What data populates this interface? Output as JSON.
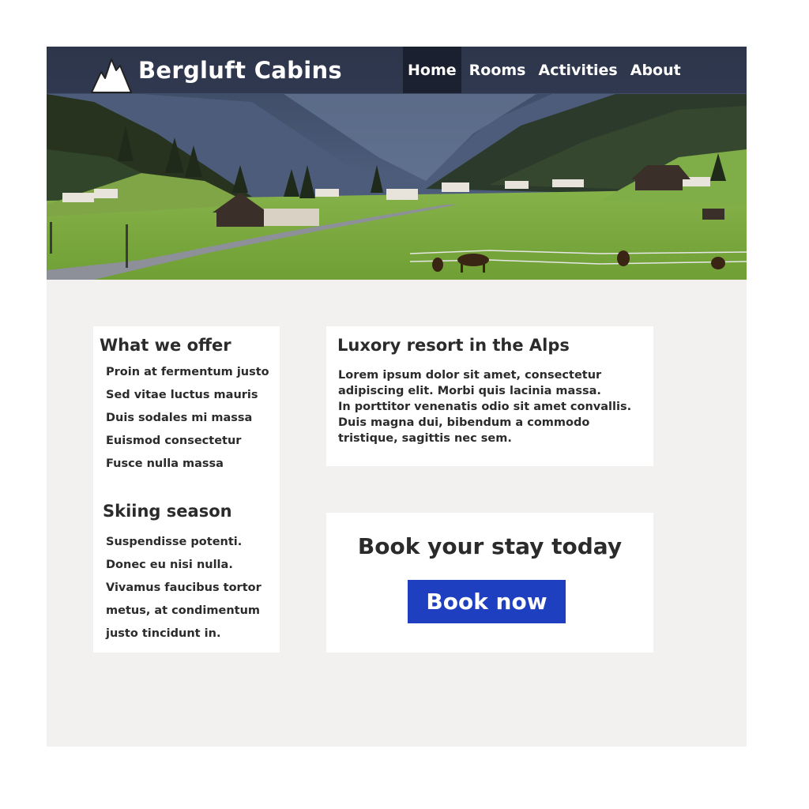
{
  "header": {
    "logo_icon": "mountain-peaks-icon",
    "site_title": "Bergluft Cabins",
    "nav": [
      "Home",
      "Rooms",
      "Activities",
      "About"
    ],
    "active_nav": "Home"
  },
  "hero": {
    "image": "alpine-valley-photo"
  },
  "offer": {
    "title": "What we offer",
    "items": [
      "Proin at fermentum justo",
      "Sed vitae luctus mauris",
      "Duis sodales mi massa",
      "Euismod consectetur",
      "Fusce nulla massa"
    ]
  },
  "skiing": {
    "title": "Skiing season",
    "items": [
      "Suspendisse potenti.",
      "Donec eu nisi nulla.",
      "Vivamus faucibus tortor",
      "metus, at condimentum",
      "justo tincidunt in."
    ]
  },
  "resort": {
    "title": "Luxory resort in the Alps",
    "lines": [
      "Lorem ipsum dolor sit amet, consectetur",
      "adipiscing elit. Morbi quis lacinia massa.",
      "In porttitor venenatis odio sit amet convallis.",
      "Duis magna dui, bibendum a commodo",
      "tristique, sagittis nec sem."
    ]
  },
  "booking": {
    "heading": "Book your stay today",
    "button_label": "Book now"
  },
  "colors": {
    "page_background": "#f2f1ef",
    "card_background": "#ffffff",
    "text": "#2b2b2b",
    "button": "#1e3fbf",
    "header_overlay": "#22283a"
  }
}
